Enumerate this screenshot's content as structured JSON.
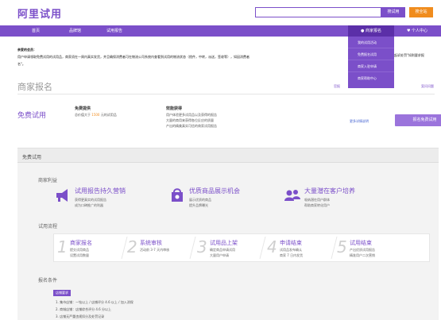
{
  "header": {
    "logo": "阿里试用",
    "search_button": "搜试用",
    "site_button": "搜全站"
  },
  "nav": {
    "items": [
      "首页",
      "品牌馆",
      "试用报告"
    ],
    "merchant_menu": "商家报名",
    "personal_center": "个人中心"
  },
  "dropdown": {
    "items": [
      "我的试用活动",
      "免费报名试用",
      "商家入驻申请",
      "商家帮助中心"
    ]
  },
  "notice": {
    "greeting": "亲爱的会员：",
    "line1": "用户申请领取免费试用的试用品，商家须在一周内真实发货，并且确保消费者可在物流公司系统内查看到试用的物流状态（揽件，中转，派送，签收等），如因消费者",
    "line1_tail": "起诉处罚\"如则要求报",
    "line2": "名\"。"
  },
  "section": {
    "title": "商家报名",
    "link_left": "官报",
    "link_right": "案问问题"
  },
  "trial": {
    "title": "免费试用",
    "col1_title": "免费提供",
    "col1_prefix": "总价值大于",
    "col1_value": "1500",
    "col1_suffix": "元的试用品",
    "col2_title": "效能获得",
    "col2_lines": [
      "用户体验更多试用品以及获得的报告",
      "大量的商用来获得各位反应的质量",
      "产出的精美真实可信的商家试用报告"
    ],
    "more_link": "更多详情说明",
    "apply_button": "报名免费试用"
  },
  "panel": {
    "title": "免费试用",
    "benefits_title": "商家利益",
    "benefits": [
      {
        "name": "试用报告持久营销",
        "desc": [
          "获得更真实的试用报告",
          "成为口碑推广的利器"
        ],
        "icon": "megaphone-icon"
      },
      {
        "name": "优质商品展示机会",
        "desc": [
          "展示优质的商品",
          "提升品牌曝光"
        ],
        "icon": "shopping-bag-icon"
      },
      {
        "name": "大量潜在客户培养",
        "desc": [
          "吸纳潜在用户群体",
          "帮助商家转化用户"
        ],
        "icon": "users-icon"
      }
    ],
    "process_title": "试用流程",
    "steps": [
      {
        "num": "1",
        "name": "商家报名",
        "desc": [
          "提交试用商品",
          "设置试用数量"
        ]
      },
      {
        "num": "2",
        "name": "系统审核",
        "desc": [
          "活动前 3-7 天内审核"
        ]
      },
      {
        "num": "3",
        "name": "试用品上架",
        "desc": [
          "确定商品申请试用",
          "大量用户申请"
        ]
      },
      {
        "num": "4",
        "name": "申请结束",
        "desc": [
          "试用品发布确认",
          "商家 7 日内发货"
        ]
      },
      {
        "num": "5",
        "name": "试用结束",
        "desc": [
          "产出优质试用报告",
          "精准用户二次营销"
        ]
      }
    ],
    "conditions_title": "报名条件",
    "store_badge": "店铺要求",
    "conditions": [
      "1. 集市店铺：一钻以上 / 店铺评分 4.6 以上 / 加入消保",
      "2. 商城店铺：店铺综合评分 4.6 分以上",
      "3. 店铺无严重违规扣分及处罚记录"
    ]
  },
  "colors": {
    "accent": "#7b4fc9",
    "orange": "#f08c1d",
    "highlight": "#f08c1d"
  }
}
